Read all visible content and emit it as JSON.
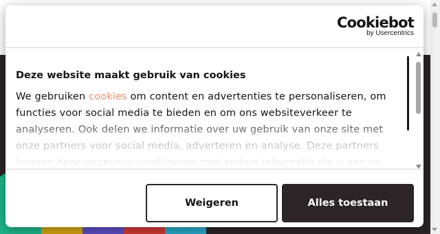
{
  "dialog": {
    "logo": {
      "name": "Cookiebot",
      "sub": "by Usercentrics"
    },
    "title": "Deze website maakt gebruik van cookies",
    "text_before_link": "We gebruiken ",
    "link_text": "cookies",
    "text_after_link": " om content en advertenties te personaliseren, om functies voor social media te bieden en om ons websiteverkeer te analyseren. Ook delen we informatie over uw gebruik van onze site met onze partners voor social media, adverteren en analyse. Deze partners kunnen deze gegevens combineren met andere informatie die u aan ze heeft verstrekt of die ze hebben verzameld op basis van uw gebruik van hun services.",
    "buttons": {
      "deny": "Weigeren",
      "allow": "Alles toestaan"
    }
  },
  "colors": {
    "accent": "#f08e6c",
    "dark": "#2c2426",
    "stripes": [
      "#1fb58a",
      "#d4a513",
      "#5b4fc4",
      "#d13a36",
      "#2aa9c8"
    ]
  }
}
